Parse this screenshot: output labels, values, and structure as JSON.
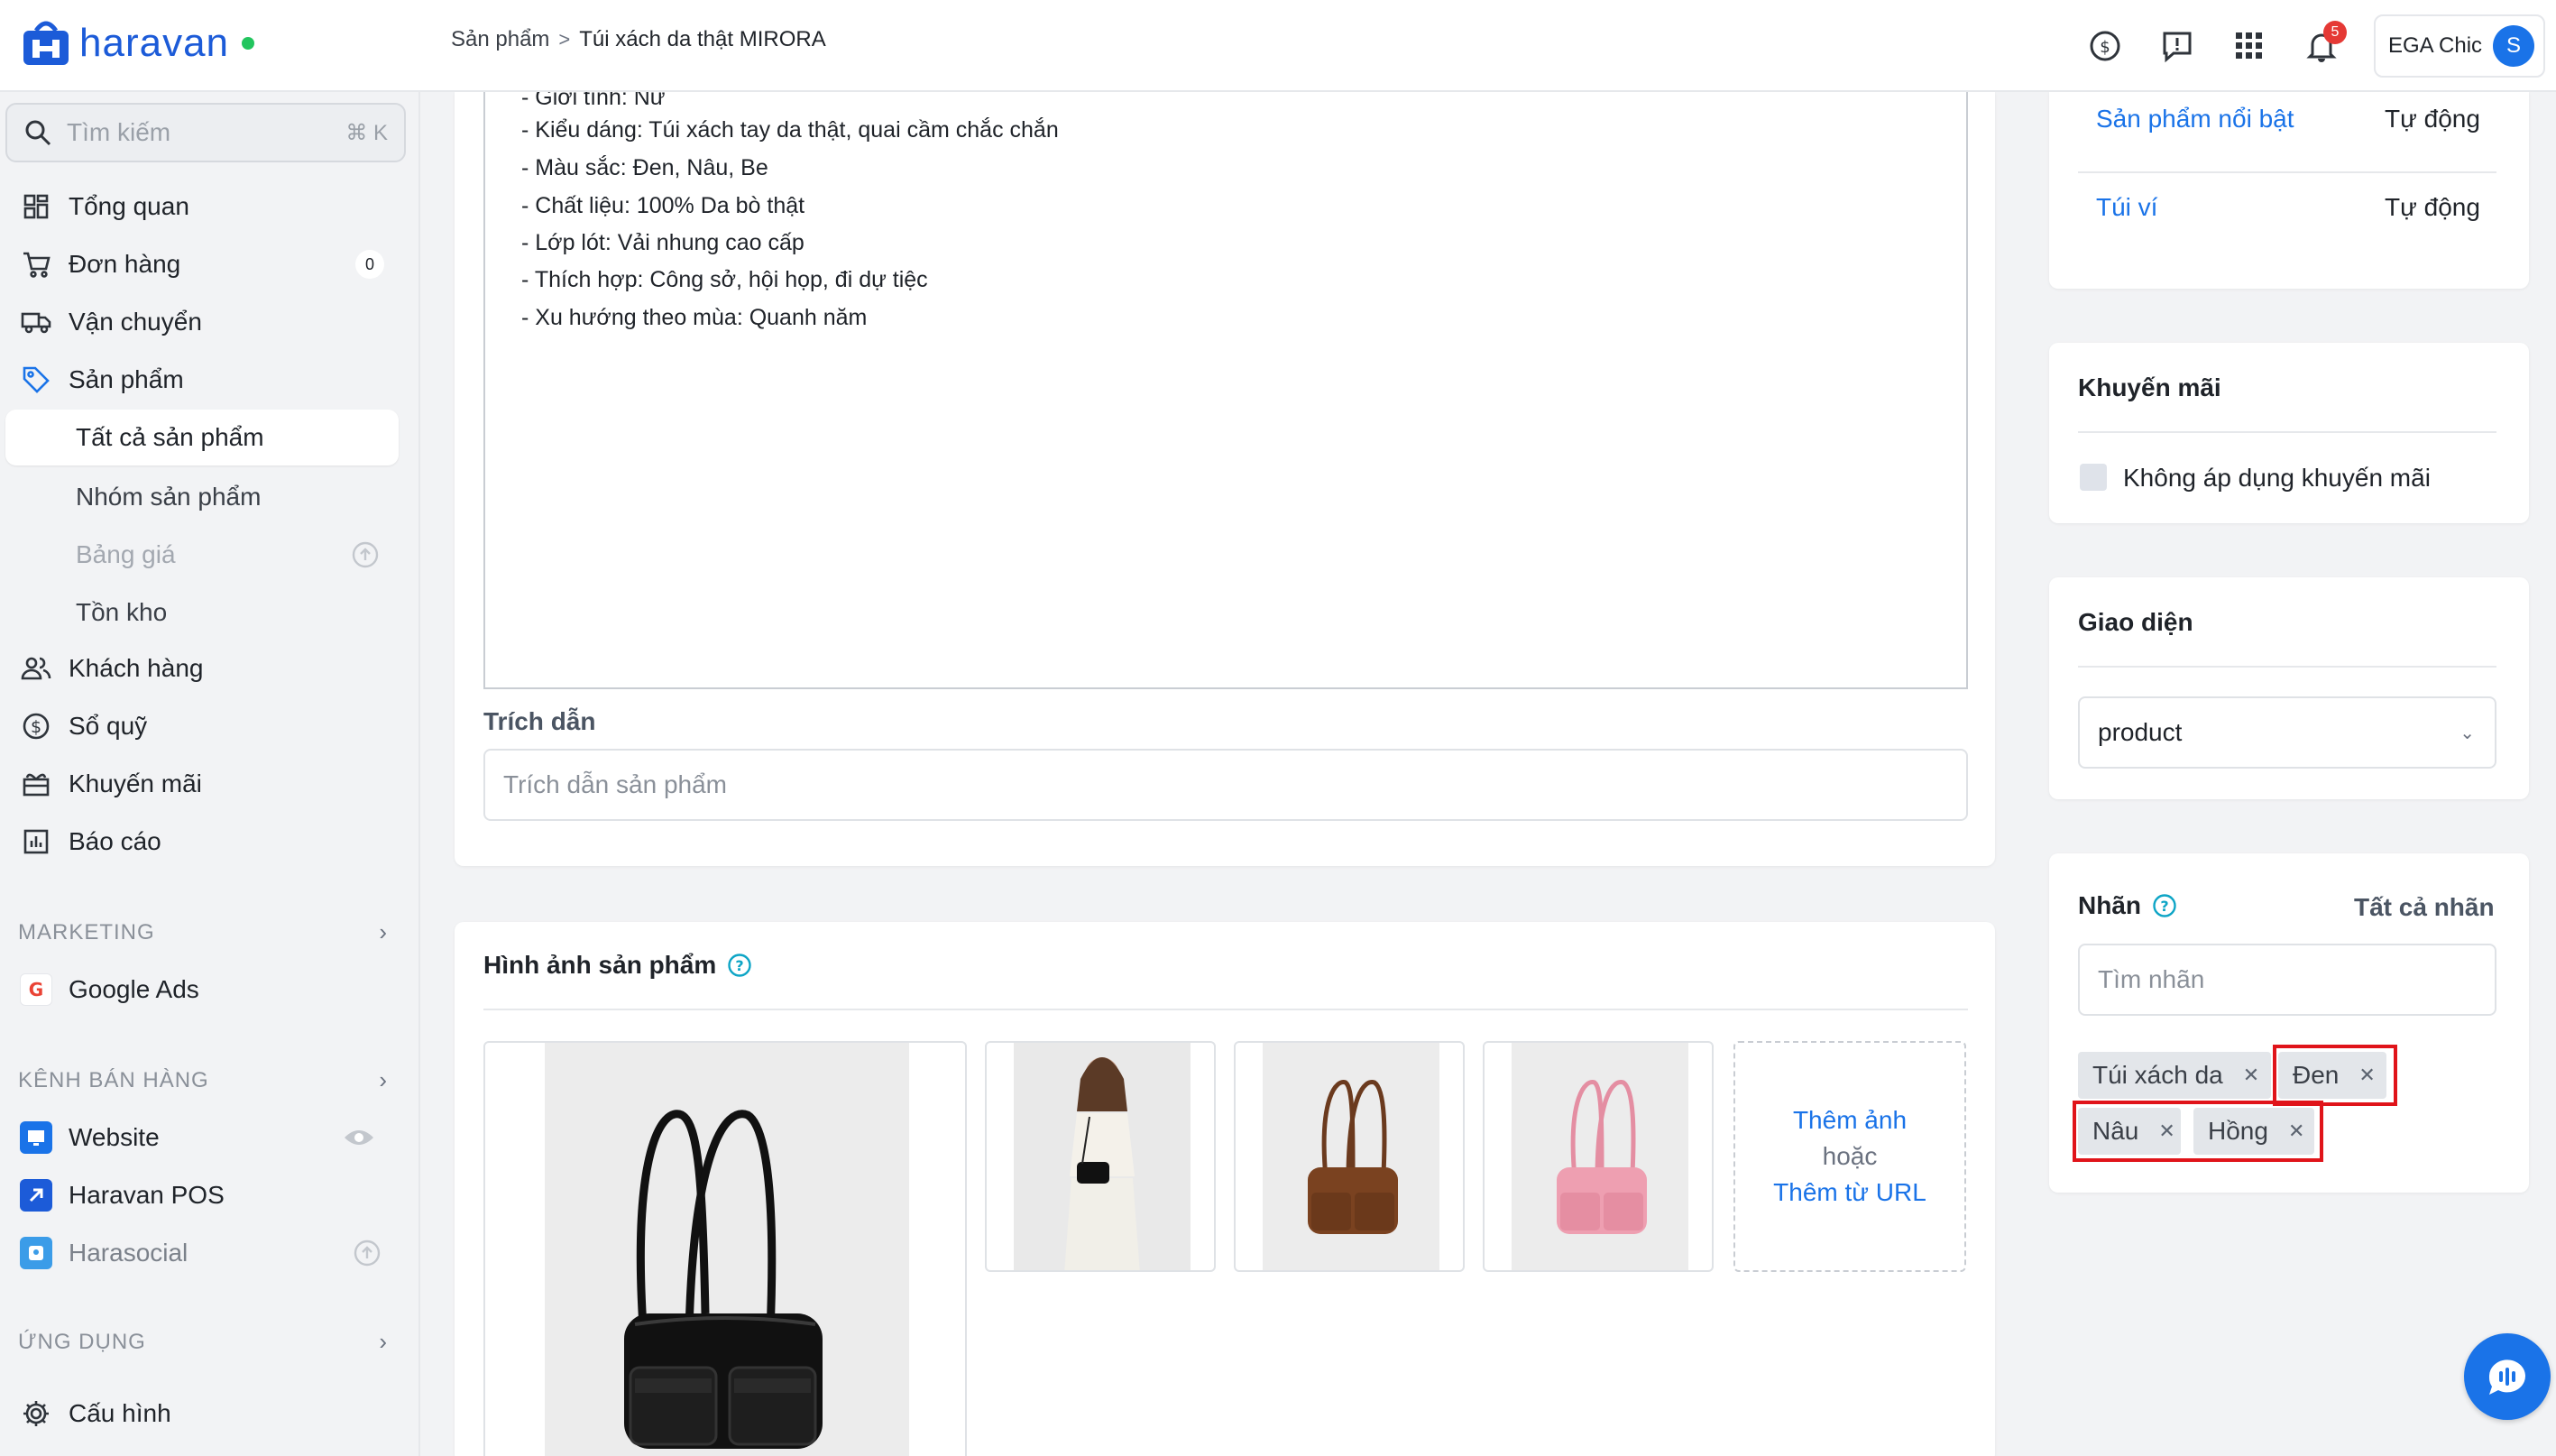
{
  "app": {
    "name": "haravan",
    "brand_color": "#1c5bd8",
    "online_color": "#22c55e"
  },
  "breadcrumb": {
    "parent": "Sản phẩm",
    "separator": ">",
    "current": "Túi xách da thật MIRORA"
  },
  "topbar": {
    "notification_count": "5",
    "store_name": "EGA Chic",
    "avatar_initial": "S"
  },
  "sidebar": {
    "search": {
      "placeholder": "Tìm kiếm",
      "shortcut": "⌘ K"
    },
    "items": [
      {
        "label": "Tổng quan",
        "icon": "dashboard-icon"
      },
      {
        "label": "Đơn hàng",
        "icon": "cart-icon",
        "badge": "0"
      },
      {
        "label": "Vận chuyển",
        "icon": "truck-icon"
      },
      {
        "label": "Sản phẩm",
        "icon": "tag-icon"
      }
    ],
    "sub_items": [
      {
        "label": "Tất cả sản phẩm",
        "active": true
      },
      {
        "label": "Nhóm sản phẩm"
      },
      {
        "label": "Bảng giá",
        "muted": true
      },
      {
        "label": "Tồn kho"
      }
    ],
    "items2": [
      {
        "label": "Khách hàng",
        "icon": "customers-icon"
      },
      {
        "label": "Sổ quỹ",
        "icon": "dollar-icon"
      },
      {
        "label": "Khuyến mãi",
        "icon": "gift-icon"
      },
      {
        "label": "Báo cáo",
        "icon": "report-icon"
      }
    ],
    "marketing": {
      "title": "MARKETING",
      "items": [
        {
          "label": "Google Ads"
        }
      ]
    },
    "sales_channels": {
      "title": "KÊNH BÁN HÀNG",
      "items": [
        {
          "label": "Website"
        },
        {
          "label": "Haravan POS"
        },
        {
          "label": "Harasocial"
        }
      ]
    },
    "apps": {
      "title": "ỨNG DỤNG"
    },
    "settings": {
      "label": "Cấu hình"
    }
  },
  "editor": {
    "lines": [
      "- Giới tính: Nữ",
      "- Kiểu dáng: Túi xách tay da thật, quai cầm chắc chắn",
      "- Màu sắc: Đen, Nâu, Be",
      "- Chất liệu: 100% Da bò thật",
      "- Lớp lót: Vải nhung cao cấp",
      "- Thích hợp: Công sở, hội họp, đi dự tiệc",
      "- Xu hướng theo mùa: Quanh năm"
    ]
  },
  "excerpt": {
    "label": "Trích dẫn",
    "placeholder": "Trích dẫn sản phẩm"
  },
  "images": {
    "title": "Hình ảnh sản phẩm",
    "add_image": "Thêm ảnh",
    "or": "hoặc",
    "add_from_url": "Thêm từ URL"
  },
  "collections": {
    "rows": [
      {
        "name": "Sản phẩm nổi bật",
        "type": "Tự động"
      },
      {
        "name": "Túi ví",
        "type": "Tự động"
      }
    ]
  },
  "promotion": {
    "title": "Khuyến mãi",
    "checkbox_label": "Không áp dụng khuyến mãi"
  },
  "theme": {
    "title": "Giao diện",
    "selected": "product"
  },
  "tags": {
    "title": "Nhãn",
    "all_link": "Tất cả nhãn",
    "search_placeholder": "Tìm nhãn",
    "items": [
      "Túi xách da",
      "Đen",
      "Nâu",
      "Hồng"
    ],
    "highlight_color": "#e0141a"
  }
}
